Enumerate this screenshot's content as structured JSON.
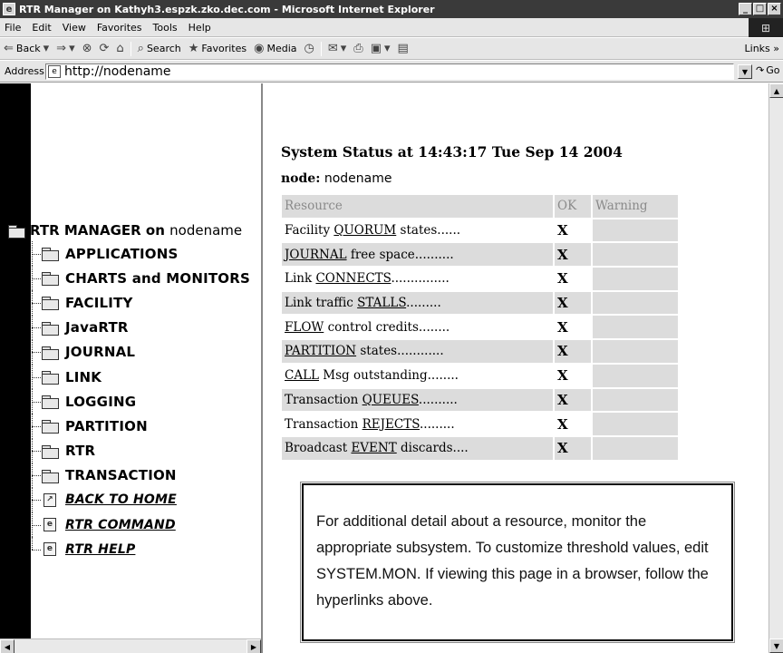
{
  "window": {
    "title": "RTR Manager on Kathyh3.espzk.zko.dec.com - Microsoft Internet Explorer",
    "controls": [
      "_",
      "□",
      "×"
    ]
  },
  "menu": [
    "File",
    "Edit",
    "View",
    "Favorites",
    "Tools",
    "Help"
  ],
  "toolbar": {
    "back": "Back",
    "search": "Search",
    "favorites": "Favorites",
    "media": "Media",
    "links": "Links »"
  },
  "address": {
    "label": "Address",
    "url": "http://nodename",
    "go": "Go"
  },
  "tree": {
    "root_label": "RTR MANAGER on",
    "root_host": "nodename",
    "folders": [
      "APPLICATIONS",
      "CHARTS and MONITORS",
      "FACILITY",
      "JavaRTR",
      "JOURNAL",
      "LINK",
      "LOGGING",
      "PARTITION",
      "RTR",
      "TRANSACTION"
    ],
    "links": [
      "BACK TO HOME",
      "RTR COMMAND",
      "RTR HELP"
    ]
  },
  "status": {
    "title": "System Status at 14:43:17 Tue Sep 14 2004",
    "node_label": "node:",
    "node_value": "nodename",
    "columns": [
      "Resource",
      "OK",
      "Warning"
    ],
    "rows": [
      {
        "pre": "Facility ",
        "link": "QUORUM",
        "post": " states......",
        "ok": "X",
        "warning": ""
      },
      {
        "pre": "",
        "link": "JOURNAL",
        "post": " free space..........",
        "ok": "X",
        "warning": ""
      },
      {
        "pre": "Link ",
        "link": "CONNECTS",
        "post": "...............",
        "ok": "X",
        "warning": ""
      },
      {
        "pre": "Link traffic ",
        "link": "STALLS",
        "post": ".........",
        "ok": "X",
        "warning": ""
      },
      {
        "pre": "",
        "link": "FLOW",
        "post": " control credits........",
        "ok": "X",
        "warning": ""
      },
      {
        "pre": "",
        "link": "PARTITION",
        "post": " states............",
        "ok": "X",
        "warning": ""
      },
      {
        "pre": "",
        "link": "CALL",
        "post": " Msg outstanding........",
        "ok": "X",
        "warning": ""
      },
      {
        "pre": "Transaction ",
        "link": "QUEUES",
        "post": "..........",
        "ok": "X",
        "warning": ""
      },
      {
        "pre": "Transaction ",
        "link": "REJECTS",
        "post": ".........",
        "ok": "X",
        "warning": ""
      },
      {
        "pre": "Broadcast ",
        "link": "EVENT",
        "post": " discards....",
        "ok": "X",
        "warning": ""
      }
    ],
    "note": "For additional detail about a resource, monitor the appropriate subsystem. To customize threshold values, edit SYSTEM.MON. If viewing this page in a browser, follow the hyperlinks above."
  }
}
